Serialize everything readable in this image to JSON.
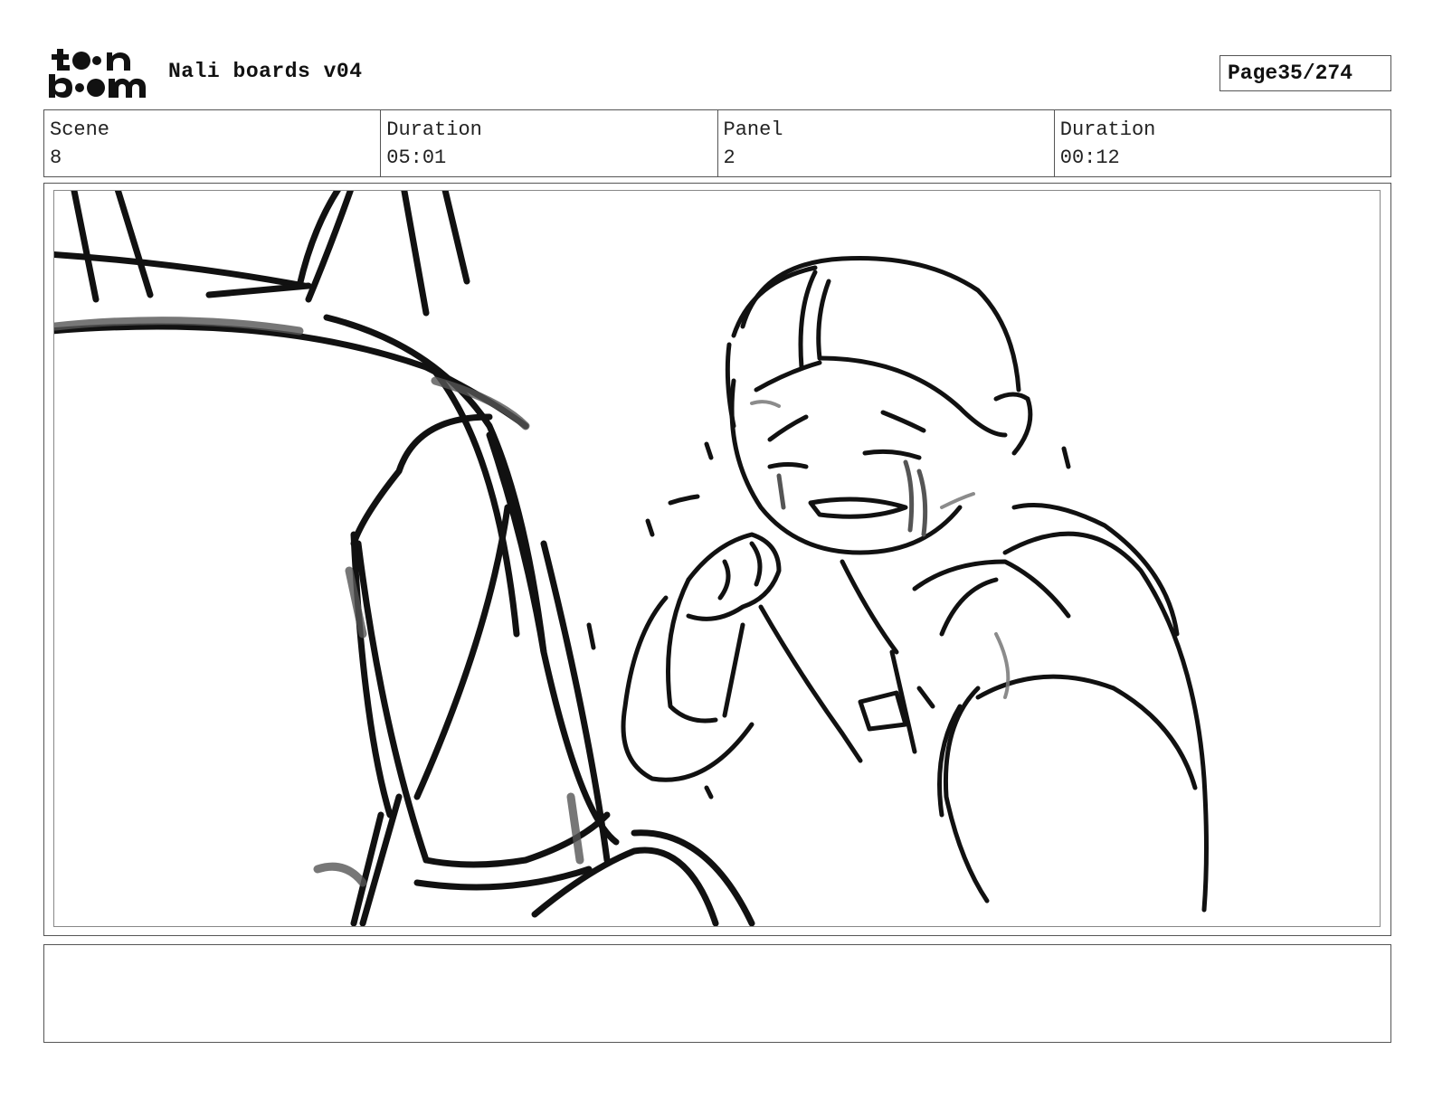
{
  "header": {
    "logo_text": "toon boom",
    "title": "Nali boards v04",
    "page_label": "Page",
    "page_value": "35/274"
  },
  "info": {
    "scene_label": "Scene",
    "scene_value": "8",
    "scene_duration_label": "Duration",
    "scene_duration_value": "05:01",
    "panel_label": "Panel",
    "panel_value": "2",
    "panel_duration_label": "Duration",
    "panel_duration_value": "00:12"
  },
  "notes": {
    "text": ""
  },
  "icons": {
    "logo": "toon-boom-logo"
  }
}
